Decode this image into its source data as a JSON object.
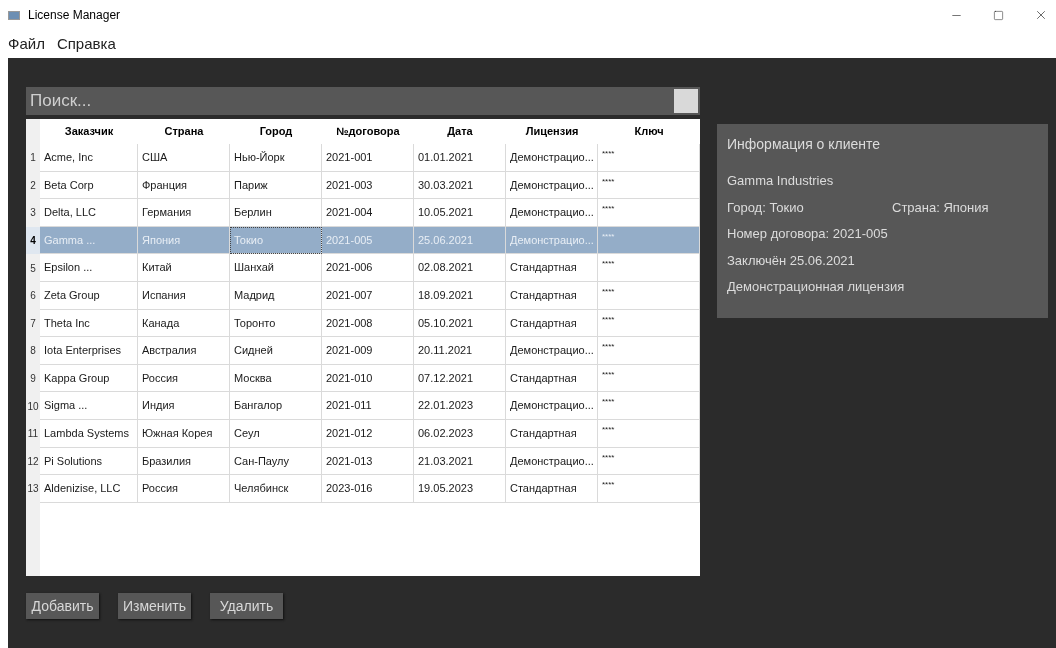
{
  "window": {
    "title": "License Manager"
  },
  "menu": [
    "Файл",
    "Справка"
  ],
  "search": {
    "placeholder": "Поиск..."
  },
  "table": {
    "columns": [
      "Заказчик",
      "Страна",
      "Город",
      "№договора",
      "Дата",
      "Лицензия",
      "Ключ"
    ],
    "rows": [
      {
        "number": "1",
        "cells": [
          "Acme, Inc",
          "США",
          "Нью-Йорк",
          "2021-001",
          "01.01.2021",
          "Демонстрацио...",
          "****"
        ],
        "selected": false
      },
      {
        "number": "2",
        "cells": [
          "Beta Corp",
          "Франция",
          "Париж",
          "2021-003",
          "30.03.2021",
          "Демонстрацио...",
          "****"
        ],
        "selected": false
      },
      {
        "number": "3",
        "cells": [
          "Delta, LLC",
          "Германия",
          "Берлин",
          "2021-004",
          "10.05.2021",
          "Демонстрацио...",
          "****"
        ],
        "selected": false
      },
      {
        "number": "4",
        "cells": [
          "Gamma ...",
          "Япония",
          "Токио",
          "2021-005",
          "25.06.2021",
          "Демонстрацио...",
          "****"
        ],
        "selected": true
      },
      {
        "number": "5",
        "cells": [
          "Epsilon ...",
          "Китай",
          "Шанхай",
          "2021-006",
          "02.08.2021",
          "Стандартная",
          "****"
        ],
        "selected": false
      },
      {
        "number": "6",
        "cells": [
          "Zeta Group",
          "Испания",
          "Мадрид",
          "2021-007",
          "18.09.2021",
          "Стандартная",
          "****"
        ],
        "selected": false
      },
      {
        "number": "7",
        "cells": [
          "Theta Inc",
          "Канада",
          "Торонто",
          "2021-008",
          "05.10.2021",
          "Стандартная",
          "****"
        ],
        "selected": false
      },
      {
        "number": "8",
        "cells": [
          "Iota Enterprises",
          "Австралия",
          "Сидней",
          "2021-009",
          "20.11.2021",
          "Демонстрацио...",
          "****"
        ],
        "selected": false
      },
      {
        "number": "9",
        "cells": [
          "Kappa Group",
          "Россия",
          "Москва",
          "2021-010",
          "07.12.2021",
          "Стандартная",
          "****"
        ],
        "selected": false
      },
      {
        "number": "10",
        "cells": [
          "Sigma ...",
          "Индия",
          "Бангалор",
          "2021-011",
          "22.01.2023",
          "Демонстрацио...",
          "****"
        ],
        "selected": false
      },
      {
        "number": "11",
        "cells": [
          "Lambda Systems",
          "Южная Корея",
          "Сеул",
          "2021-012",
          "06.02.2023",
          "Стандартная",
          "****"
        ],
        "selected": false
      },
      {
        "number": "12",
        "cells": [
          "Pi Solutions",
          "Бразилия",
          "Сан-Паулу",
          "2021-013",
          "21.03.2021",
          "Демонстрацио...",
          "****"
        ],
        "selected": false
      },
      {
        "number": "13",
        "cells": [
          "Aldenizise, LLC",
          "Россия",
          "Челябинск",
          "2023-016",
          "19.05.2023",
          "Стандартная",
          "****"
        ],
        "selected": false
      }
    ]
  },
  "info_panel": {
    "title": "Информация о клиенте",
    "name": "Gamma Industries",
    "city": "Город: Токио",
    "country": "Страна: Япония",
    "contract": "Номер договора: 2021-005",
    "concluded": "Заключён 25.06.2021",
    "license": "Демонстрационная лицензия"
  },
  "buttons": [
    "Добавить",
    "Изменить",
    "Удалить"
  ]
}
